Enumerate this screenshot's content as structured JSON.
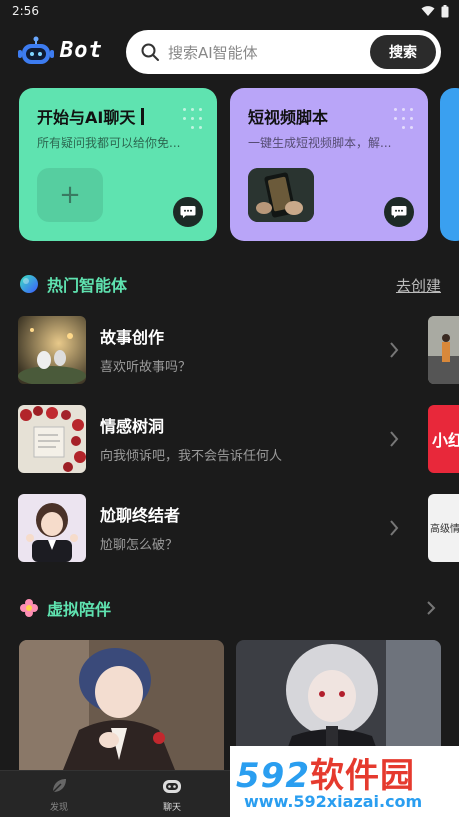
{
  "status_bar": {
    "time": "2:56"
  },
  "header": {
    "brand": "Bot",
    "search_placeholder": "搜索AI智能体",
    "search_button": "搜索"
  },
  "cards": [
    {
      "title": "开始与AI聊天",
      "subtitle": "所有疑问我都可以给你免..."
    },
    {
      "title": "短视频脚本",
      "subtitle": "一键生成短视频脚本，解..."
    }
  ],
  "hot_section": {
    "title": "热门智能体",
    "action": "去创建"
  },
  "agents": [
    {
      "name": "故事创作",
      "desc": "喜欢听故事吗？"
    },
    {
      "name": "情感树洞",
      "desc": "向我倾诉吧，我不会告诉任何人"
    },
    {
      "name": "尬聊终结者",
      "desc": "尬聊怎么破？"
    }
  ],
  "peek_labels": [
    "小红",
    "高级情"
  ],
  "companion_section": {
    "title": "虚拟陪伴"
  },
  "bottom_nav": [
    {
      "label": "发现"
    },
    {
      "label": "聊天"
    }
  ],
  "watermark": {
    "brand_num": "592",
    "brand_cn": "软件园",
    "url": "www.592xiazai.com"
  },
  "colors": {
    "accent": "#5fe3b0",
    "card_green": "#5fe3b0",
    "card_purple": "#b9a5f8",
    "background": "#1b1b1b"
  }
}
